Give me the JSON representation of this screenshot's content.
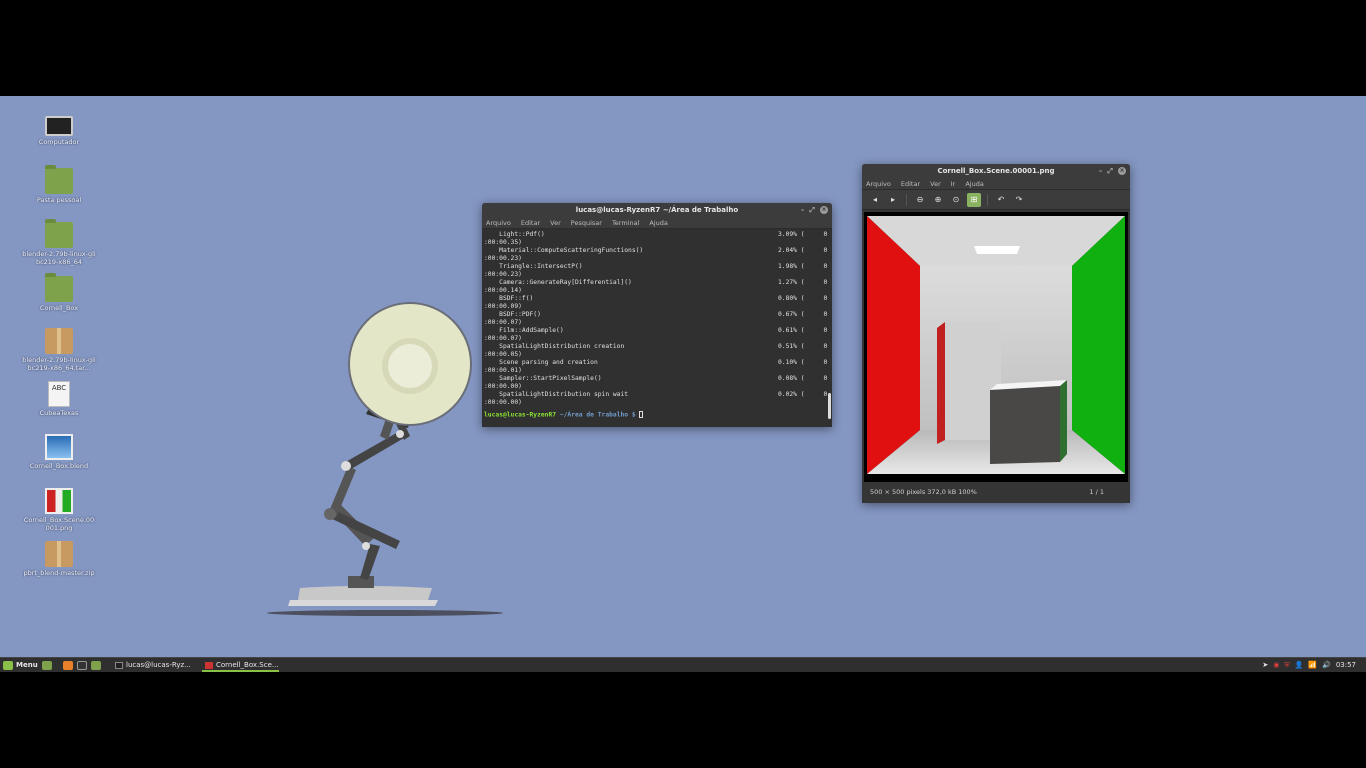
{
  "desktop": {
    "icons": [
      {
        "label": "Computador",
        "icon": "computer-icon"
      },
      {
        "label": "Pasta pessoal",
        "icon": "home-folder-icon"
      },
      {
        "label": "blender-2.79b-linux-glibc219-x86_64",
        "icon": "folder-icon"
      },
      {
        "label": "Cornell_Box",
        "icon": "folder-icon"
      },
      {
        "label": "blender-2.79b-linux-glibc219-x86_64.tar...",
        "icon": "archive-icon"
      },
      {
        "label": "CubeaTexas",
        "icon": "text-file-icon"
      },
      {
        "label": "Cornell_Box.blend",
        "icon": "blend-file-icon"
      },
      {
        "label": "Cornell_Box.Scene.00001.png",
        "icon": "png-file-icon"
      },
      {
        "label": "pbrt_blend-master.zip",
        "icon": "zip-archive-icon"
      }
    ]
  },
  "terminal": {
    "title": "lucas@lucas-RyzenR7 ~/Área de Trabalho",
    "menu": [
      "Arquivo",
      "Editar",
      "Ver",
      "Pesquisar",
      "Terminal",
      "Ajuda"
    ],
    "rows": [
      {
        "name": "    Light::Pdf()",
        "pct": "3.09% (     0"
      },
      {
        "name": ":00:00.35)",
        "pct": ""
      },
      {
        "name": "    Material::ComputeScatteringFunctions()",
        "pct": "2.04% (     0"
      },
      {
        "name": ":00:00.23)",
        "pct": ""
      },
      {
        "name": "    Triangle::IntersectP()",
        "pct": "1.98% (     0"
      },
      {
        "name": ":00:00.23)",
        "pct": ""
      },
      {
        "name": "    Camera::GenerateRay[Differential]()",
        "pct": "1.27% (     0"
      },
      {
        "name": ":00:00.14)",
        "pct": ""
      },
      {
        "name": "    BSDF::f()",
        "pct": "0.80% (     0"
      },
      {
        "name": ":00:00.09)",
        "pct": ""
      },
      {
        "name": "    BSDF::PDF()",
        "pct": "0.67% (     0"
      },
      {
        "name": ":00:00.07)",
        "pct": ""
      },
      {
        "name": "    Film::AddSample()",
        "pct": "0.61% (     0"
      },
      {
        "name": ":00:00.07)",
        "pct": ""
      },
      {
        "name": "    SpatialLightDistribution creation",
        "pct": "0.51% (     0"
      },
      {
        "name": ":00:00.05)",
        "pct": ""
      },
      {
        "name": "    Scene parsing and creation",
        "pct": "0.10% (     0"
      },
      {
        "name": ":00:00.01)",
        "pct": ""
      },
      {
        "name": "    Sampler::StartPixelSample()",
        "pct": "0.08% (     0"
      },
      {
        "name": ":00:00.00)",
        "pct": ""
      },
      {
        "name": "    SpatialLightDistribution spin wait",
        "pct": "0.02% (     0"
      },
      {
        "name": ":00:00.00)",
        "pct": ""
      }
    ],
    "prompt_user": "lucas@lucas-RyzenR7",
    "prompt_path": "~/Área de Trabalho $"
  },
  "viewer": {
    "title": "Cornell_Box.Scene.00001.png",
    "menu": [
      "Arquivo",
      "Editar",
      "Ver",
      "Ir",
      "Ajuda"
    ],
    "toolbar": [
      "back-arrow-icon",
      "forward-arrow-icon",
      "zoom-out-icon",
      "zoom-in-icon",
      "zoom-fit-icon",
      "zoom-best-fit-icon",
      "rotate-left-icon",
      "rotate-right-icon"
    ],
    "status": "500 × 500 pixels  372,0 kB   100%",
    "page": "1 / 1"
  },
  "panel": {
    "menu_label": "Menu",
    "tasks": [
      {
        "label": "lucas@lucas-Ryz...",
        "active": false
      },
      {
        "label": "Cornell_Box.Sce...",
        "active": true
      }
    ],
    "clock": "03:57"
  },
  "colors": {
    "desktop_bg": "#8497c3",
    "accent": "#8ac048",
    "terminal_bg": "#303030"
  }
}
